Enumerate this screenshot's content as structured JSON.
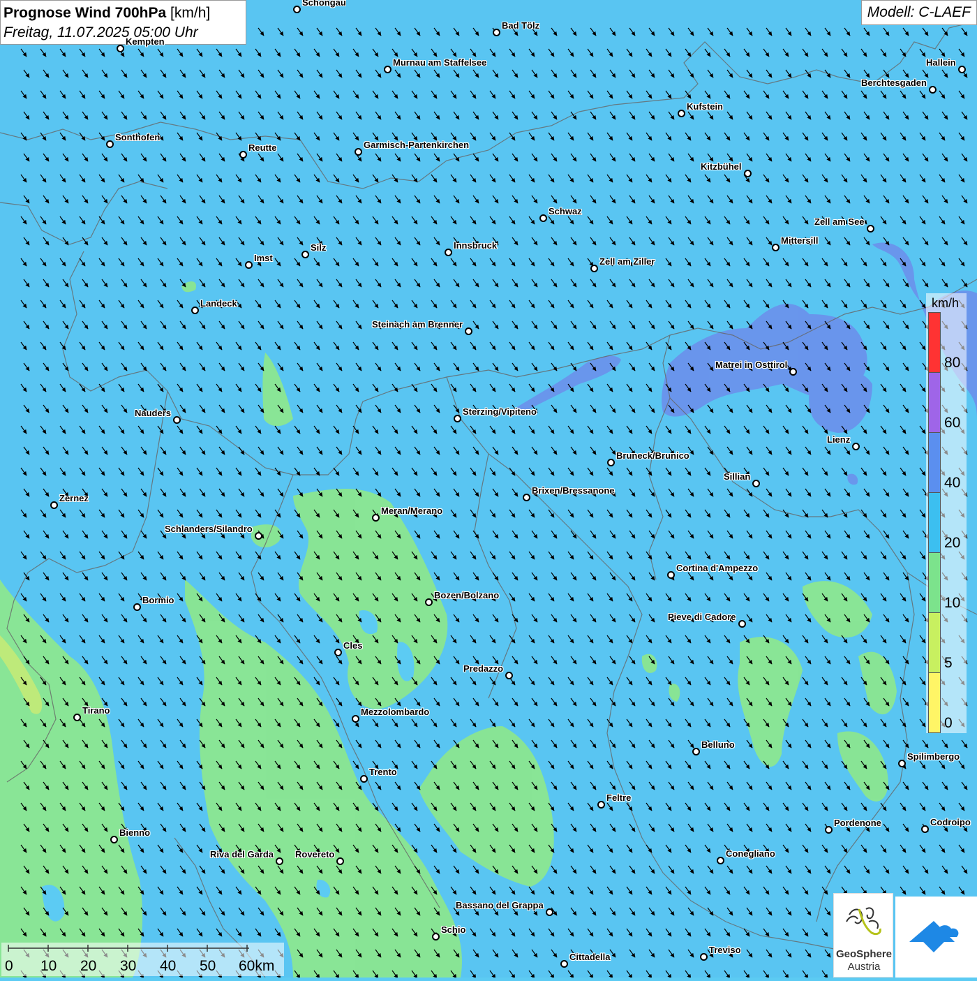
{
  "title": {
    "main": "Prognose Wind 700hPa",
    "unit": "[km/h]",
    "datetime": "Freitag, 11.07.2025 05:00 Uhr"
  },
  "model": "Modell: C-LAEF",
  "legend": {
    "unit": "km/h",
    "labels": [
      "80",
      "60",
      "40",
      "20",
      "10",
      "5",
      "0"
    ],
    "colors": [
      "#ff3333",
      "#9f65e8",
      "#5b8fef",
      "#3cbff0",
      "#7ce38c",
      "#c8f060",
      "#fff566"
    ]
  },
  "scalebar": {
    "labels": [
      "0",
      "10",
      "20",
      "30",
      "40",
      "50",
      "60km"
    ]
  },
  "logo": {
    "line1": "GeoSphere",
    "line2": "Austria"
  },
  "wind_direction": "northwest",
  "cities": [
    "Schongau",
    "Bad Tölz",
    "Kempten",
    "Murnau am Staffelsee",
    "Hallein",
    "Berchtesgaden",
    "Kufstein",
    "Sonthofen",
    "Reutte",
    "Garmisch-Partenkirchen",
    "Kitzbühel",
    "Schwaz",
    "Zell am See",
    "Mittersill",
    "Innsbruck",
    "Silz",
    "Imst",
    "Zell am Ziller",
    "Landeck",
    "Steinach am Brenner",
    "Matrei in Osttirol",
    "Nauders",
    "Sterzing/Vipiteno",
    "Lienz",
    "Bruneck/Brunico",
    "Sillian",
    "Zernez",
    "Brixen/Bressanone",
    "Meran/Merano",
    "Schlanders/Silandro",
    "Cortina d'Ampezzo",
    "Bormio",
    "Bozen/Bolzano",
    "Pieve di Cadore",
    "Cles",
    "Predazzo",
    "Tirano",
    "Mezzolombardo",
    "Belluno",
    "Spilimbergo",
    "Trento",
    "Feltre",
    "Bienno",
    "Pordenone",
    "Codroipo",
    "Riva del Garda",
    "Rovereto",
    "Conegliano",
    "Bassano del Grappa",
    "Schio",
    "Treviso",
    "Cittadella"
  ]
}
